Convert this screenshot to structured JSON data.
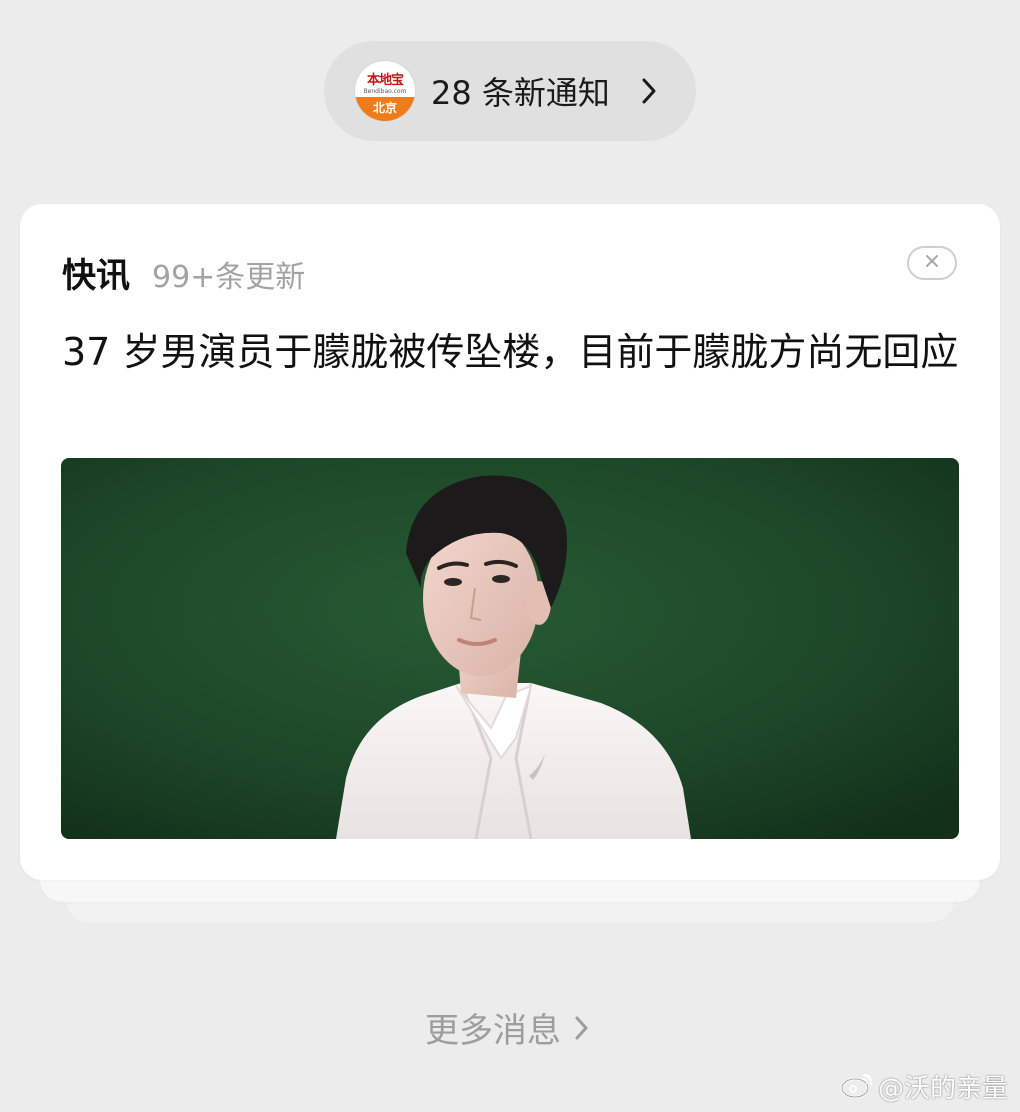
{
  "notification_pill": {
    "app_logo": {
      "brand_text": "本地宝",
      "brand_subtext": "Bendibao.com",
      "city_text": "北京"
    },
    "label": "28 条新通知",
    "chevron_icon": "chevron-right-icon"
  },
  "card": {
    "title": "快讯",
    "update_count": "99+条更新",
    "close_icon": "close-icon",
    "headline": "37 岁男演员于朦胧被传坠楼，目前于朦胧方尚无回应",
    "image_icon": "news-photo"
  },
  "more_messages": {
    "label": "更多消息",
    "chevron_icon": "chevron-right-icon"
  },
  "watermark": {
    "text": "@沃的亲量",
    "icon": "weibo-icon"
  },
  "colors": {
    "background": "#ececec",
    "pill": "#e0e0e0",
    "card": "#ffffff",
    "muted_text": "#a3a3a3",
    "logo_orange": "#f07b19",
    "logo_red": "#c4161c",
    "photo_background": "#1f4a2b"
  }
}
